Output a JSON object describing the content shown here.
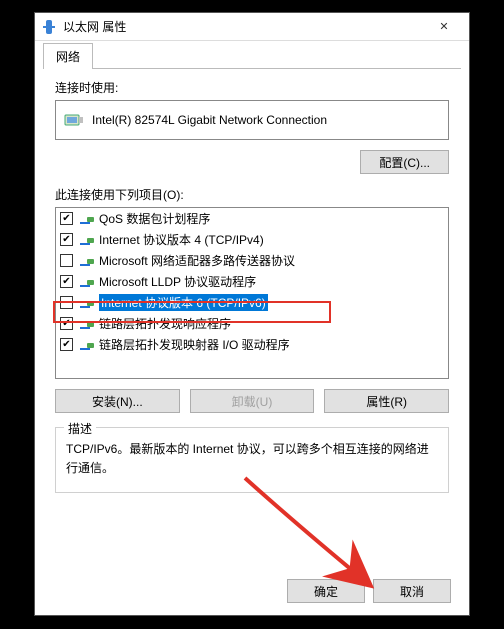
{
  "window": {
    "title": "以太网 属性"
  },
  "tab": {
    "label": "网络"
  },
  "connectUsing": {
    "label": "连接时使用:",
    "adapter": "Intel(R) 82574L Gigabit Network Connection",
    "configureBtn": "配置(C)..."
  },
  "itemsSection": {
    "label": "此连接使用下列项目(O):",
    "items": [
      {
        "checked": true,
        "label": "QoS 数据包计划程序",
        "selected": false
      },
      {
        "checked": true,
        "label": "Internet 协议版本 4 (TCP/IPv4)",
        "selected": false
      },
      {
        "checked": false,
        "label": "Microsoft 网络适配器多路传送器协议",
        "selected": false
      },
      {
        "checked": true,
        "label": "Microsoft LLDP 协议驱动程序",
        "selected": false
      },
      {
        "checked": false,
        "label": "Internet 协议版本 6 (TCP/IPv6)",
        "selected": true
      },
      {
        "checked": true,
        "label": "链路层拓扑发现响应程序",
        "selected": false
      },
      {
        "checked": true,
        "label": "链路层拓扑发现映射器 I/O 驱动程序",
        "selected": false
      }
    ],
    "installBtn": "安装(N)...",
    "uninstallBtn": "卸载(U)",
    "propertiesBtn": "属性(R)"
  },
  "description": {
    "groupLabel": "描述",
    "text": "TCP/IPv6。最新版本的 Internet 协议，可以跨多个相互连接的网络进行通信。"
  },
  "footer": {
    "ok": "确定",
    "cancel": "取消"
  }
}
